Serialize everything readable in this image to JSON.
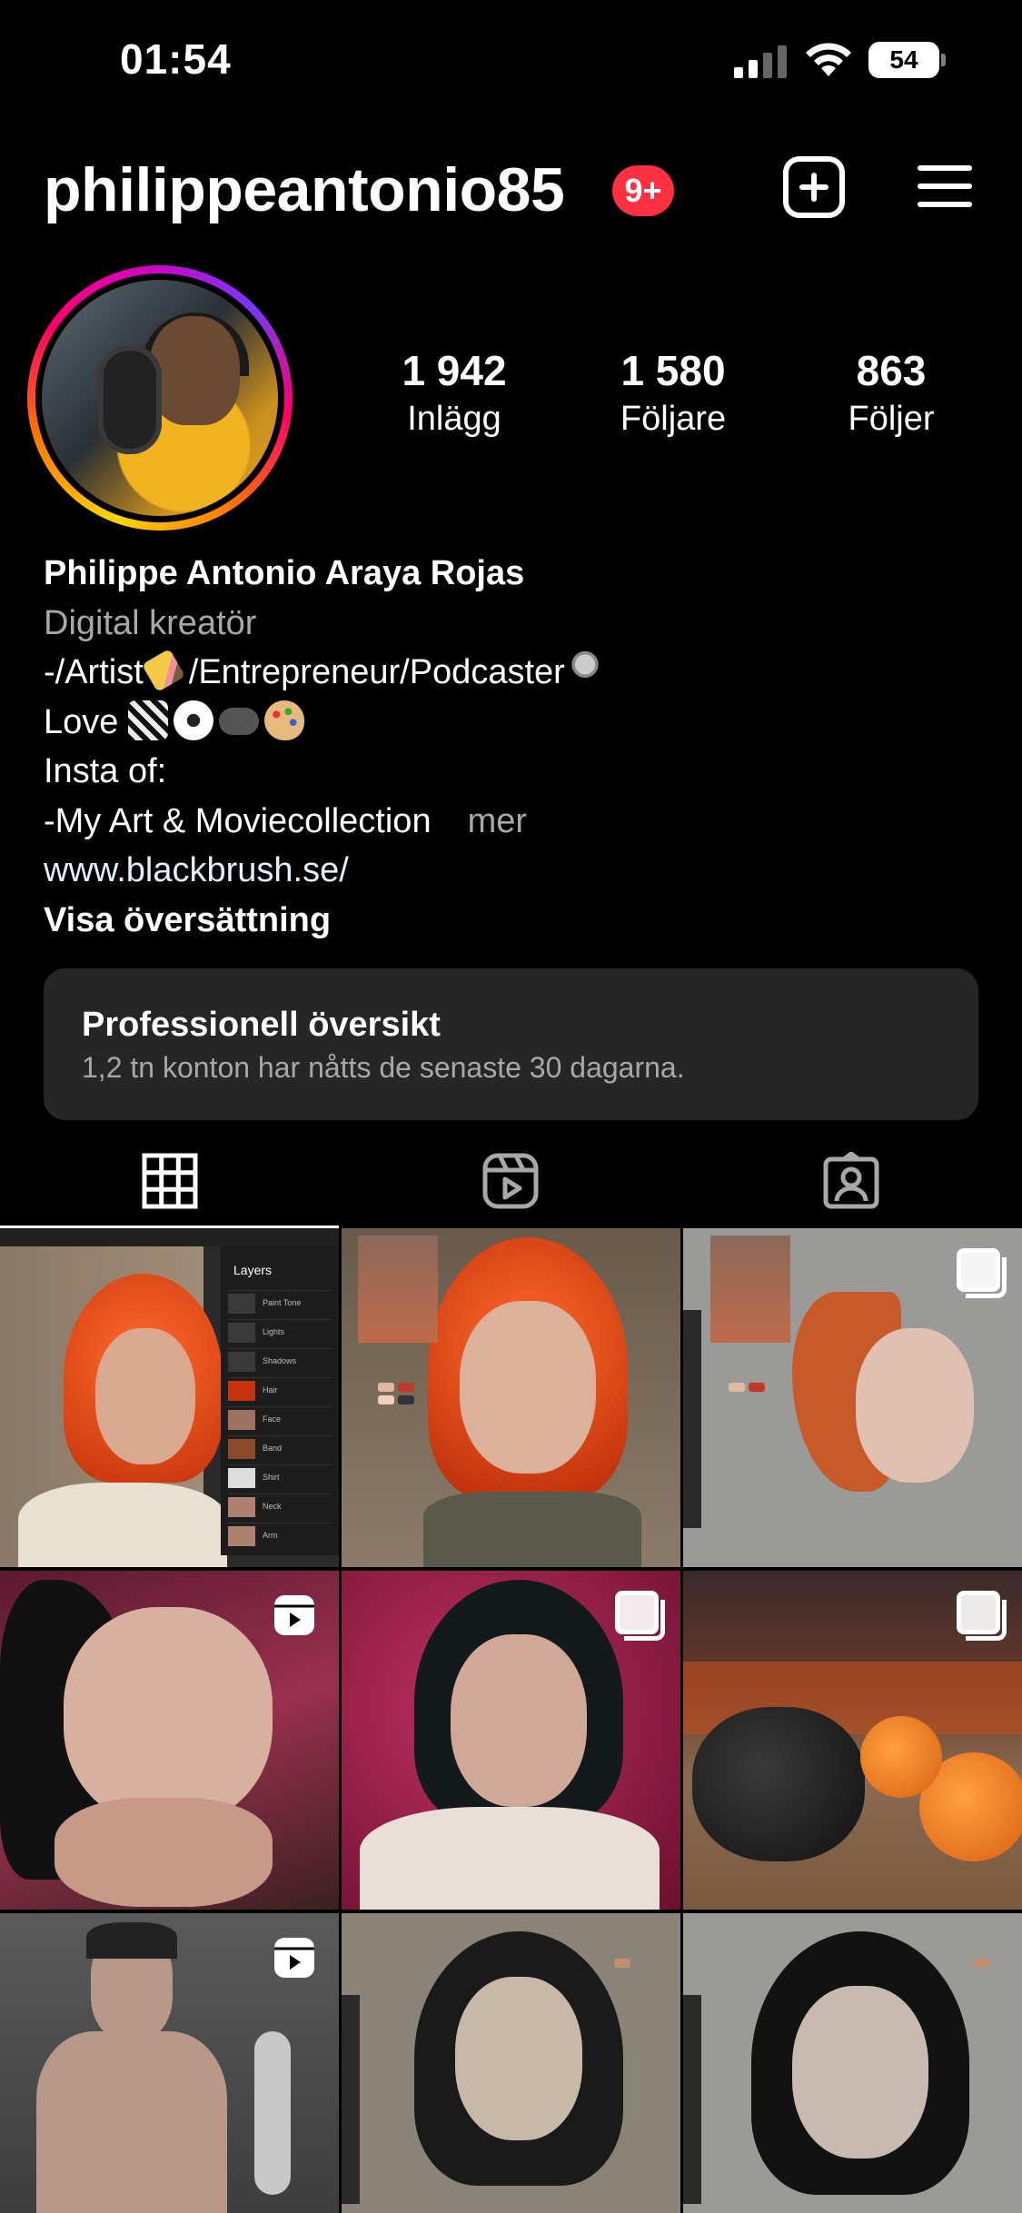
{
  "status_bar": {
    "time": "01:54",
    "battery": "54"
  },
  "header": {
    "username": "philippeantonio85",
    "notifications_badge": "9+"
  },
  "stats": [
    {
      "value": "1 942",
      "label": "Inlägg"
    },
    {
      "value": "1 580",
      "label": "Följare"
    },
    {
      "value": "863",
      "label": "Följer"
    }
  ],
  "bio": {
    "name": "Philippe Antonio Araya Rojas",
    "category": "Digital kreatör",
    "line1": "-/Artist",
    "line1b": "/Entrepreneur/Podcaster",
    "line2": "Love",
    "line3": "Insta of:",
    "line4": "-My Art & Moviecollection",
    "more": "mer",
    "link": "www.blackbrush.se/",
    "translate": "Visa översättning"
  },
  "professional_dashboard": {
    "title": "Professionell översikt",
    "subtitle": "1,2 tn konton har nåtts de senaste 30 dagarna."
  },
  "tabs": [
    {
      "icon": "grid-icon",
      "active": true
    },
    {
      "icon": "reels-icon",
      "active": false
    },
    {
      "icon": "tagged-icon",
      "active": false
    }
  ],
  "grid": {
    "layers_title": "Layers",
    "layer_names": [
      "Paint Tone",
      "Lights",
      "Shadows",
      "Hair",
      "Face",
      "Band",
      "Shirt",
      "Neck",
      "Arm"
    ],
    "posts": [
      {
        "subject": "procreate-leeloo",
        "badge": "none"
      },
      {
        "subject": "leeloo-painting",
        "badge": "none"
      },
      {
        "subject": "leeloo-sketch",
        "badge": "carousel"
      },
      {
        "subject": "mia-wallace-close",
        "badge": "reel"
      },
      {
        "subject": "mia-wallace-red",
        "badge": "carousel"
      },
      {
        "subject": "teapot-oranges",
        "badge": "carousel"
      },
      {
        "subject": "terminator-man",
        "badge": "reel"
      },
      {
        "subject": "mia-wallace-sketch",
        "badge": "none"
      },
      {
        "subject": "mia-wallace-gray",
        "badge": "none"
      }
    ]
  },
  "colors": {
    "badge_red": "#ff3040",
    "panel_bg": "#262626",
    "secondary_text": "#a8a8a8"
  }
}
